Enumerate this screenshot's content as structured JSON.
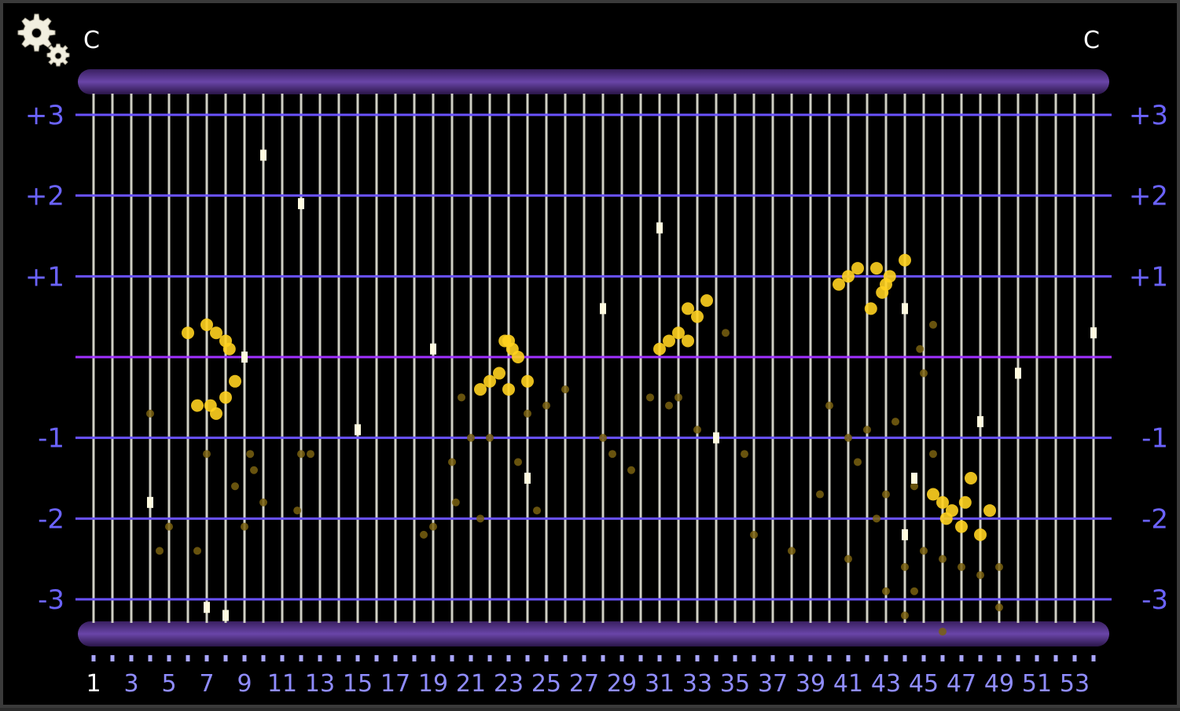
{
  "header": {
    "left_label": "C",
    "right_label": "C"
  },
  "icons": {
    "settings": "gears-icon"
  },
  "colors": {
    "background": "#000000",
    "string_line": "#cfcfc4",
    "fret_line": "#6a52ff",
    "center_line": "#a030ff",
    "axis_label": "#6b63ff",
    "note_marker": "#ffd21f",
    "bar": "#5a3a8a",
    "marker_white": "#fffbe0"
  },
  "chart_data": {
    "type": "scatter",
    "title": "",
    "xlabel": "",
    "ylabel": "",
    "xlim": [
      1,
      54
    ],
    "ylim": [
      -3,
      3
    ],
    "grid": true,
    "x_tick_labels": [
      "1",
      "3",
      "5",
      "7",
      "9",
      "11",
      "13",
      "15",
      "17",
      "19",
      "21",
      "23",
      "25",
      "27",
      "29",
      "31",
      "33",
      "35",
      "37",
      "39",
      "41",
      "43",
      "45",
      "47",
      "49",
      "51",
      "53"
    ],
    "y_tick_labels_left": [
      "+3",
      "+2",
      "+1",
      "-1",
      "-2",
      "-3"
    ],
    "y_tick_values": [
      3,
      2,
      1,
      -1,
      -2,
      -3
    ],
    "y_tick_labels_right": [
      "+3",
      "+2",
      "+1",
      "-1",
      "-2",
      "-3"
    ],
    "center_line_value": 0,
    "points_bright": [
      [
        7,
        0.4
      ],
      [
        7.5,
        0.3
      ],
      [
        8,
        0.2
      ],
      [
        8.2,
        0.1
      ],
      [
        8.5,
        -0.3
      ],
      [
        8,
        -0.5
      ],
      [
        7.2,
        -0.6
      ],
      [
        7.5,
        -0.7
      ],
      [
        6.5,
        -0.6
      ],
      [
        6,
        0.3
      ],
      [
        23,
        0.2
      ],
      [
        23.2,
        0.1
      ],
      [
        22.8,
        0.2
      ],
      [
        23.5,
        0
      ],
      [
        22.5,
        -0.2
      ],
      [
        21.5,
        -0.4
      ],
      [
        22,
        -0.3
      ],
      [
        24,
        -0.3
      ],
      [
        23,
        -0.4
      ],
      [
        32.5,
        0.6
      ],
      [
        33,
        0.5
      ],
      [
        32,
        0.3
      ],
      [
        33.5,
        0.7
      ],
      [
        31.5,
        0.2
      ],
      [
        31,
        0.1
      ],
      [
        32.5,
        0.2
      ],
      [
        41,
        1
      ],
      [
        40.5,
        0.9
      ],
      [
        41.5,
        1.1
      ],
      [
        42.5,
        1.1
      ],
      [
        43,
        0.9
      ],
      [
        43.2,
        1
      ],
      [
        42.8,
        0.8
      ],
      [
        44,
        1.2
      ],
      [
        42.2,
        0.6
      ],
      [
        46,
        -1.8
      ],
      [
        46.5,
        -1.9
      ],
      [
        46.2,
        -2
      ],
      [
        47,
        -2.1
      ],
      [
        45.5,
        -1.7
      ],
      [
        47.5,
        -1.5
      ],
      [
        48,
        -2.2
      ],
      [
        48.5,
        -1.9
      ],
      [
        47.2,
        -1.8
      ]
    ],
    "points_dim": [
      [
        4,
        -0.7
      ],
      [
        5,
        -2.1
      ],
      [
        4.5,
        -2.4
      ],
      [
        6.5,
        -2.4
      ],
      [
        7,
        -1.2
      ],
      [
        8.5,
        -1.6
      ],
      [
        9,
        -2.1
      ],
      [
        9.5,
        -1.4
      ],
      [
        10,
        -1.8
      ],
      [
        9.3,
        -1.2
      ],
      [
        12,
        -1.2
      ],
      [
        12.5,
        -1.2
      ],
      [
        11.8,
        -1.9
      ],
      [
        19,
        -2.1
      ],
      [
        18.5,
        -2.2
      ],
      [
        20,
        -1.3
      ],
      [
        20.5,
        -0.5
      ],
      [
        21,
        -1
      ],
      [
        20.2,
        -1.8
      ],
      [
        21.5,
        -2
      ],
      [
        22,
        -1
      ],
      [
        24,
        -0.7
      ],
      [
        25,
        -0.6
      ],
      [
        24.5,
        -1.9
      ],
      [
        23.5,
        -1.3
      ],
      [
        26,
        -0.4
      ],
      [
        28,
        -1
      ],
      [
        28.5,
        -1.2
      ],
      [
        30.5,
        -0.5
      ],
      [
        31.5,
        -0.6
      ],
      [
        32,
        -0.5
      ],
      [
        33,
        -0.9
      ],
      [
        34.5,
        0.3
      ],
      [
        35.5,
        -1.2
      ],
      [
        36,
        -2.2
      ],
      [
        29.5,
        -1.4
      ],
      [
        38,
        -2.4
      ],
      [
        39.5,
        -1.7
      ],
      [
        40,
        -0.6
      ],
      [
        41,
        -1
      ],
      [
        41.5,
        -1.3
      ],
      [
        42,
        -0.9
      ],
      [
        42.5,
        -2
      ],
      [
        43,
        -1.7
      ],
      [
        43.5,
        -0.8
      ],
      [
        44,
        -2.6
      ],
      [
        44.5,
        -1.6
      ],
      [
        45,
        -2.4
      ],
      [
        45.5,
        -1.2
      ],
      [
        46,
        -2.5
      ],
      [
        47,
        -2.6
      ],
      [
        48,
        -2.7
      ],
      [
        49,
        -2.6
      ],
      [
        41,
        -2.5
      ],
      [
        43,
        -2.9
      ],
      [
        44,
        -3.2
      ],
      [
        49,
        -3.1
      ],
      [
        46,
        -3.4
      ],
      [
        44.5,
        -2.9
      ],
      [
        45,
        -0.2
      ],
      [
        44.8,
        0.1
      ],
      [
        45.5,
        0.4
      ]
    ],
    "markers_white": [
      [
        4,
        -1.8
      ],
      [
        7,
        -3.1
      ],
      [
        8,
        -3.2
      ],
      [
        9,
        0
      ],
      [
        10,
        2.5
      ],
      [
        12,
        1.9
      ],
      [
        15,
        -0.9
      ],
      [
        19,
        0.1
      ],
      [
        24,
        -1.5
      ],
      [
        28,
        0.6
      ],
      [
        31,
        1.6
      ],
      [
        34,
        -1
      ],
      [
        44,
        0.6
      ],
      [
        44.5,
        -1.5
      ],
      [
        44,
        -2.2
      ],
      [
        48,
        -0.8
      ],
      [
        50,
        -0.2
      ],
      [
        54,
        0.3
      ]
    ]
  }
}
